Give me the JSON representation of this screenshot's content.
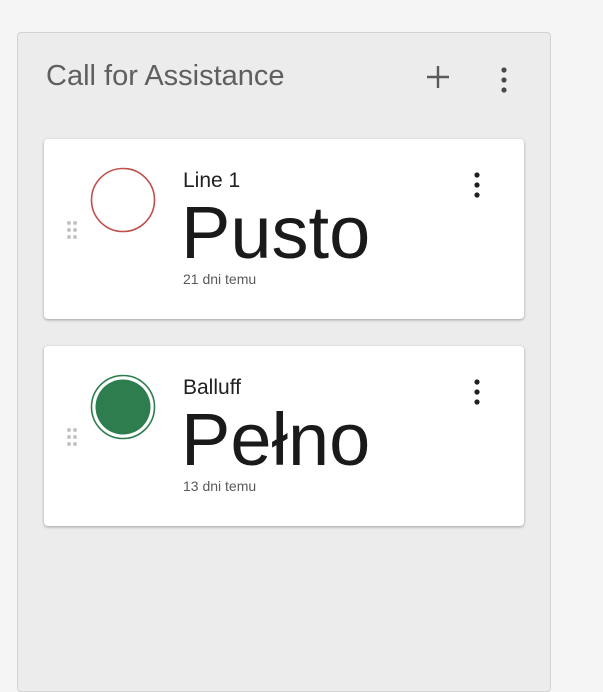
{
  "panel": {
    "title": "Call for Assistance",
    "add_icon": "plus-icon",
    "more_icon": "more-vertical-icon"
  },
  "cards": [
    {
      "label": "Line 1",
      "value": "Pusto",
      "time": "21 dni temu",
      "status_icon": "empty-circle-icon",
      "status_color": "#c0504d"
    },
    {
      "label": "Balluff",
      "value": "Pełno",
      "time": "13 dni temu",
      "status_icon": "filled-circle-icon",
      "status_color": "#2e7d4f"
    }
  ],
  "colors": {
    "panel_bg": "#ececec",
    "card_bg": "#ffffff",
    "text": "#1a1a1a"
  }
}
